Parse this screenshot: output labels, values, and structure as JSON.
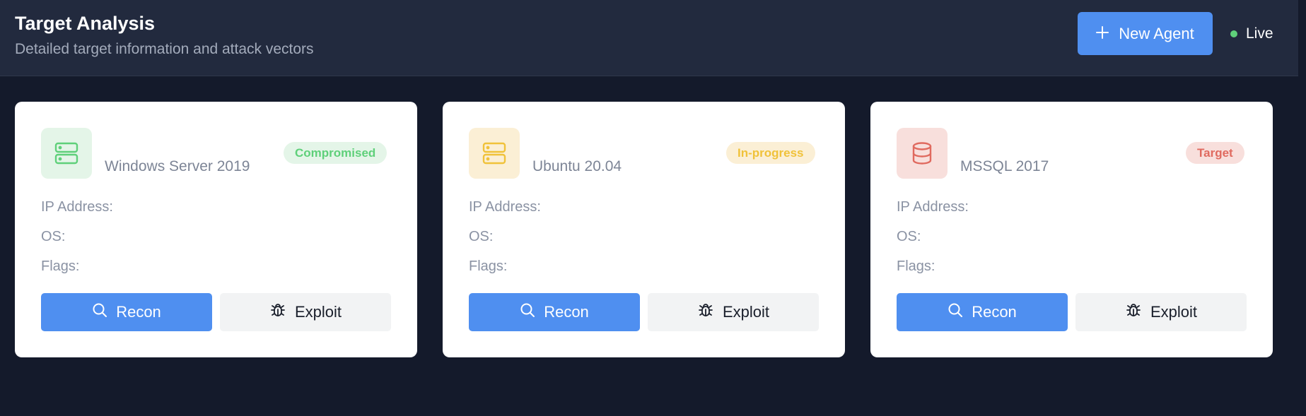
{
  "header": {
    "title": "Target Analysis",
    "subtitle": "Detailed target information and attack vectors",
    "new_agent_label": "New Agent",
    "live_label": "Live"
  },
  "cards": [
    {
      "name": "Windows Server 2019",
      "status": "Compromised",
      "icon": "server-icon",
      "ip_label": "IP Address:",
      "os_label": "OS:",
      "flags_label": "Flags:",
      "recon_label": "Recon",
      "exploit_label": "Exploit"
    },
    {
      "name": "Ubuntu 20.04",
      "status": "In-progress",
      "icon": "server-icon",
      "ip_label": "IP Address:",
      "os_label": "OS:",
      "flags_label": "Flags:",
      "recon_label": "Recon",
      "exploit_label": "Exploit"
    },
    {
      "name": "MSSQL 2017",
      "status": "Target",
      "icon": "database-icon",
      "ip_label": "IP Address:",
      "os_label": "OS:",
      "flags_label": "Flags:",
      "recon_label": "Recon",
      "exploit_label": "Exploit"
    }
  ],
  "colors": {
    "accent": "#4f8ff0",
    "compromised": "#5fd07a",
    "in_progress": "#f0c23a",
    "target": "#e06a5f",
    "live": "#5fd07a"
  }
}
